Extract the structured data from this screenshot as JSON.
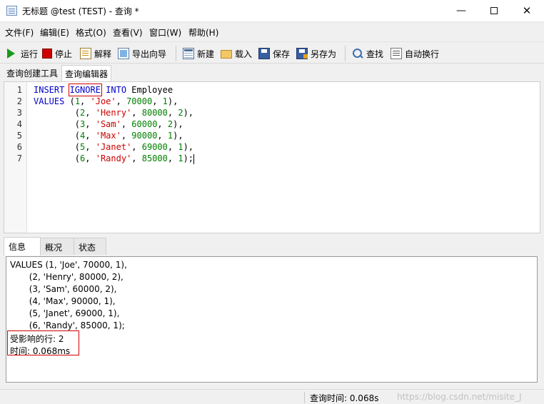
{
  "window": {
    "title": "无标题 @test (TEST) - 查询 *",
    "minimize_glyph": "—",
    "close_glyph": "✕"
  },
  "menu": [
    "文件(F)",
    "编辑(E)",
    "格式(O)",
    "查看(V)",
    "窗口(W)",
    "帮助(H)"
  ],
  "toolbar": {
    "run": "运行",
    "stop": "停止",
    "explain": "解释",
    "export_wizard": "导出向导",
    "new": "新建",
    "load": "载入",
    "save": "保存",
    "save_as": "另存为",
    "find": "查找",
    "word_wrap": "自动换行"
  },
  "editor_tabs": {
    "builder": "查询创建工具",
    "editor": "查询编辑器"
  },
  "editor": {
    "line_numbers": [
      "1",
      "2",
      "3",
      "4",
      "5",
      "6",
      "7"
    ],
    "lines": [
      [
        {
          "t": "INSERT ",
          "c": "kw"
        },
        {
          "t": "IGNORE",
          "c": "kw-box"
        },
        {
          "t": " INTO",
          "c": "kw"
        },
        {
          "t": " Employee",
          "c": "pl"
        }
      ],
      [
        {
          "t": "VALUES ",
          "c": "kw"
        },
        {
          "t": "(",
          "c": "pl"
        },
        {
          "t": "1",
          "c": "num"
        },
        {
          "t": ", ",
          "c": "pl"
        },
        {
          "t": "'Joe'",
          "c": "str"
        },
        {
          "t": ", ",
          "c": "pl"
        },
        {
          "t": "70000",
          "c": "num"
        },
        {
          "t": ", ",
          "c": "pl"
        },
        {
          "t": "1",
          "c": "num"
        },
        {
          "t": "),",
          "c": "pl"
        }
      ],
      [
        {
          "t": "        (",
          "c": "pl"
        },
        {
          "t": "2",
          "c": "num"
        },
        {
          "t": ", ",
          "c": "pl"
        },
        {
          "t": "'Henry'",
          "c": "str"
        },
        {
          "t": ", ",
          "c": "pl"
        },
        {
          "t": "80000",
          "c": "num"
        },
        {
          "t": ", ",
          "c": "pl"
        },
        {
          "t": "2",
          "c": "num"
        },
        {
          "t": "),",
          "c": "pl"
        }
      ],
      [
        {
          "t": "        (",
          "c": "pl"
        },
        {
          "t": "3",
          "c": "num"
        },
        {
          "t": ", ",
          "c": "pl"
        },
        {
          "t": "'Sam'",
          "c": "str"
        },
        {
          "t": ", ",
          "c": "pl"
        },
        {
          "t": "60000",
          "c": "num"
        },
        {
          "t": ", ",
          "c": "pl"
        },
        {
          "t": "2",
          "c": "num"
        },
        {
          "t": "),",
          "c": "pl"
        }
      ],
      [
        {
          "t": "        (",
          "c": "pl"
        },
        {
          "t": "4",
          "c": "num"
        },
        {
          "t": ", ",
          "c": "pl"
        },
        {
          "t": "'Max'",
          "c": "str"
        },
        {
          "t": ", ",
          "c": "pl"
        },
        {
          "t": "90000",
          "c": "num"
        },
        {
          "t": ", ",
          "c": "pl"
        },
        {
          "t": "1",
          "c": "num"
        },
        {
          "t": "),",
          "c": "pl"
        }
      ],
      [
        {
          "t": "        (",
          "c": "pl"
        },
        {
          "t": "5",
          "c": "num"
        },
        {
          "t": ", ",
          "c": "pl"
        },
        {
          "t": "'Janet'",
          "c": "str"
        },
        {
          "t": ", ",
          "c": "pl"
        },
        {
          "t": "69000",
          "c": "num"
        },
        {
          "t": ", ",
          "c": "pl"
        },
        {
          "t": "1",
          "c": "num"
        },
        {
          "t": "),",
          "c": "pl"
        }
      ],
      [
        {
          "t": "        (",
          "c": "pl"
        },
        {
          "t": "6",
          "c": "num"
        },
        {
          "t": ", ",
          "c": "pl"
        },
        {
          "t": "'Randy'",
          "c": "str"
        },
        {
          "t": ", ",
          "c": "pl"
        },
        {
          "t": "85000",
          "c": "num"
        },
        {
          "t": ", ",
          "c": "pl"
        },
        {
          "t": "1",
          "c": "num"
        },
        {
          "t": ");",
          "c": "pl"
        }
      ]
    ]
  },
  "result_tabs": [
    "信息",
    "概况",
    "状态"
  ],
  "result": {
    "lines": [
      "VALUES (1, 'Joe', 70000, 1),",
      "       (2, 'Henry', 80000, 2),",
      "       (3, 'Sam', 60000, 2),",
      "       (4, 'Max', 90000, 1),",
      "       (5, 'Janet', 69000, 1),",
      "       (6, 'Randy', 85000, 1);",
      "受影响的行: 2",
      "时间: 0.068ms"
    ]
  },
  "status": {
    "query_time": "查询时间: 0.068s",
    "watermark": "https://blog.csdn.net/misite_J"
  },
  "colors": {
    "keyword": "#0000cc",
    "string": "#cc0000",
    "number": "#008000",
    "highlight_box": "#d00000",
    "run_icon": "#1a9a1a",
    "stop_icon": "#d10000"
  }
}
